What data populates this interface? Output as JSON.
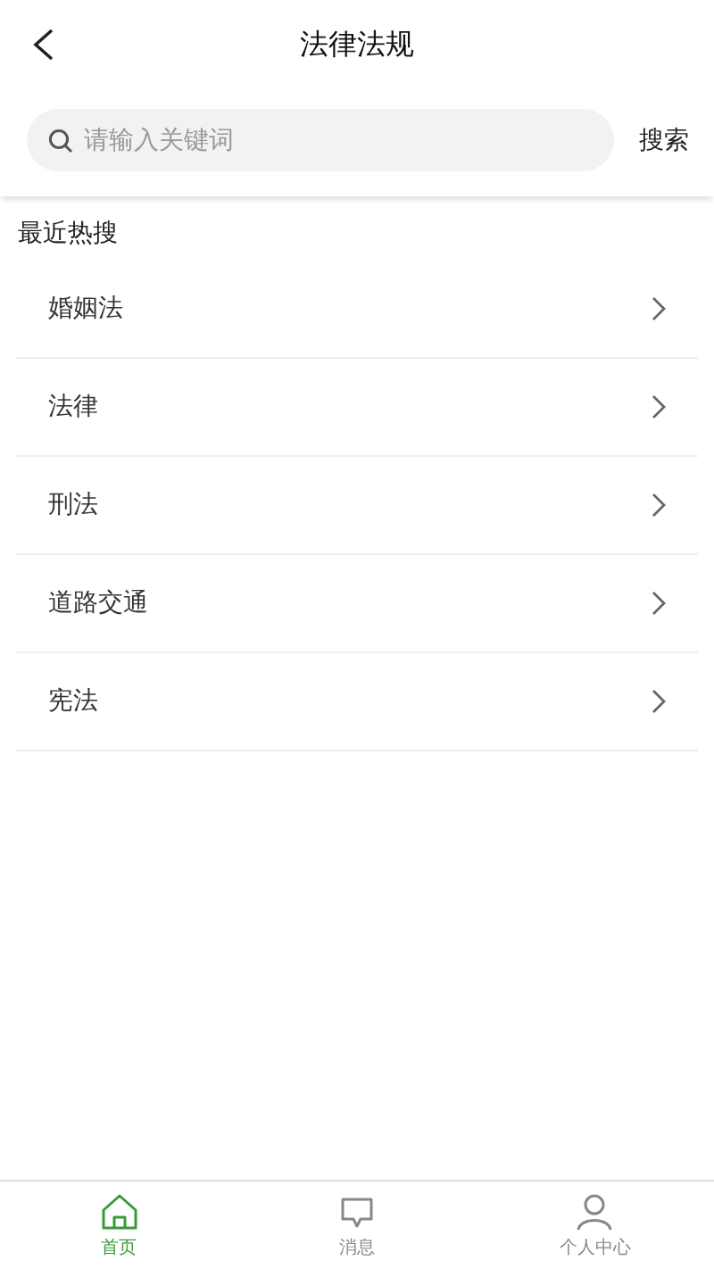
{
  "header": {
    "title": "法律法规"
  },
  "search": {
    "placeholder": "请输入关键词",
    "button": "搜索"
  },
  "section_title": "最近热搜",
  "items": [
    {
      "label": "婚姻法"
    },
    {
      "label": "法律"
    },
    {
      "label": "刑法"
    },
    {
      "label": "道路交通"
    },
    {
      "label": "宪法"
    }
  ],
  "tabs": [
    {
      "label": "首页",
      "kind": "home",
      "selected": true
    },
    {
      "label": "消息",
      "kind": "message",
      "selected": false
    },
    {
      "label": "个人中心",
      "kind": "person",
      "selected": false
    }
  ]
}
